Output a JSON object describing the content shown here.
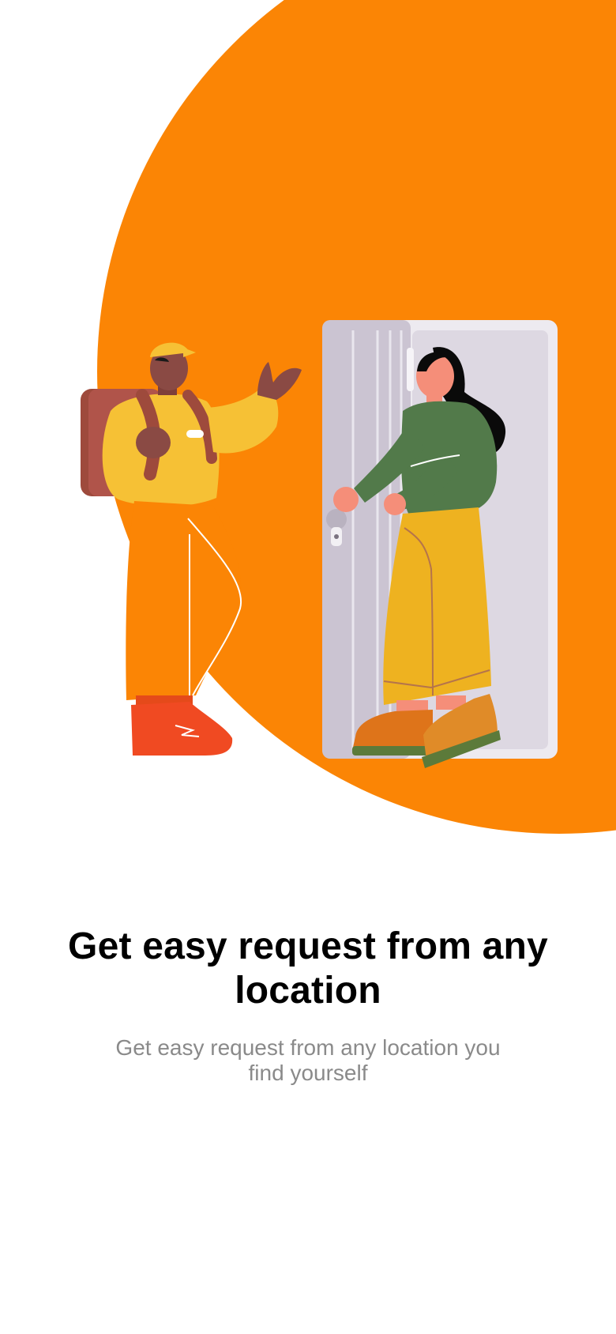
{
  "onboarding": {
    "headline": "Get easy request from any location",
    "subtitle": "Get easy request from any location you find yourself"
  },
  "illustration": {
    "name": "delivery-courier-at-door",
    "accent_color": "#FB8505"
  },
  "colors": {
    "background": "#FFFFFF",
    "headline": "#000000",
    "subtitle": "#8A8A8A"
  }
}
